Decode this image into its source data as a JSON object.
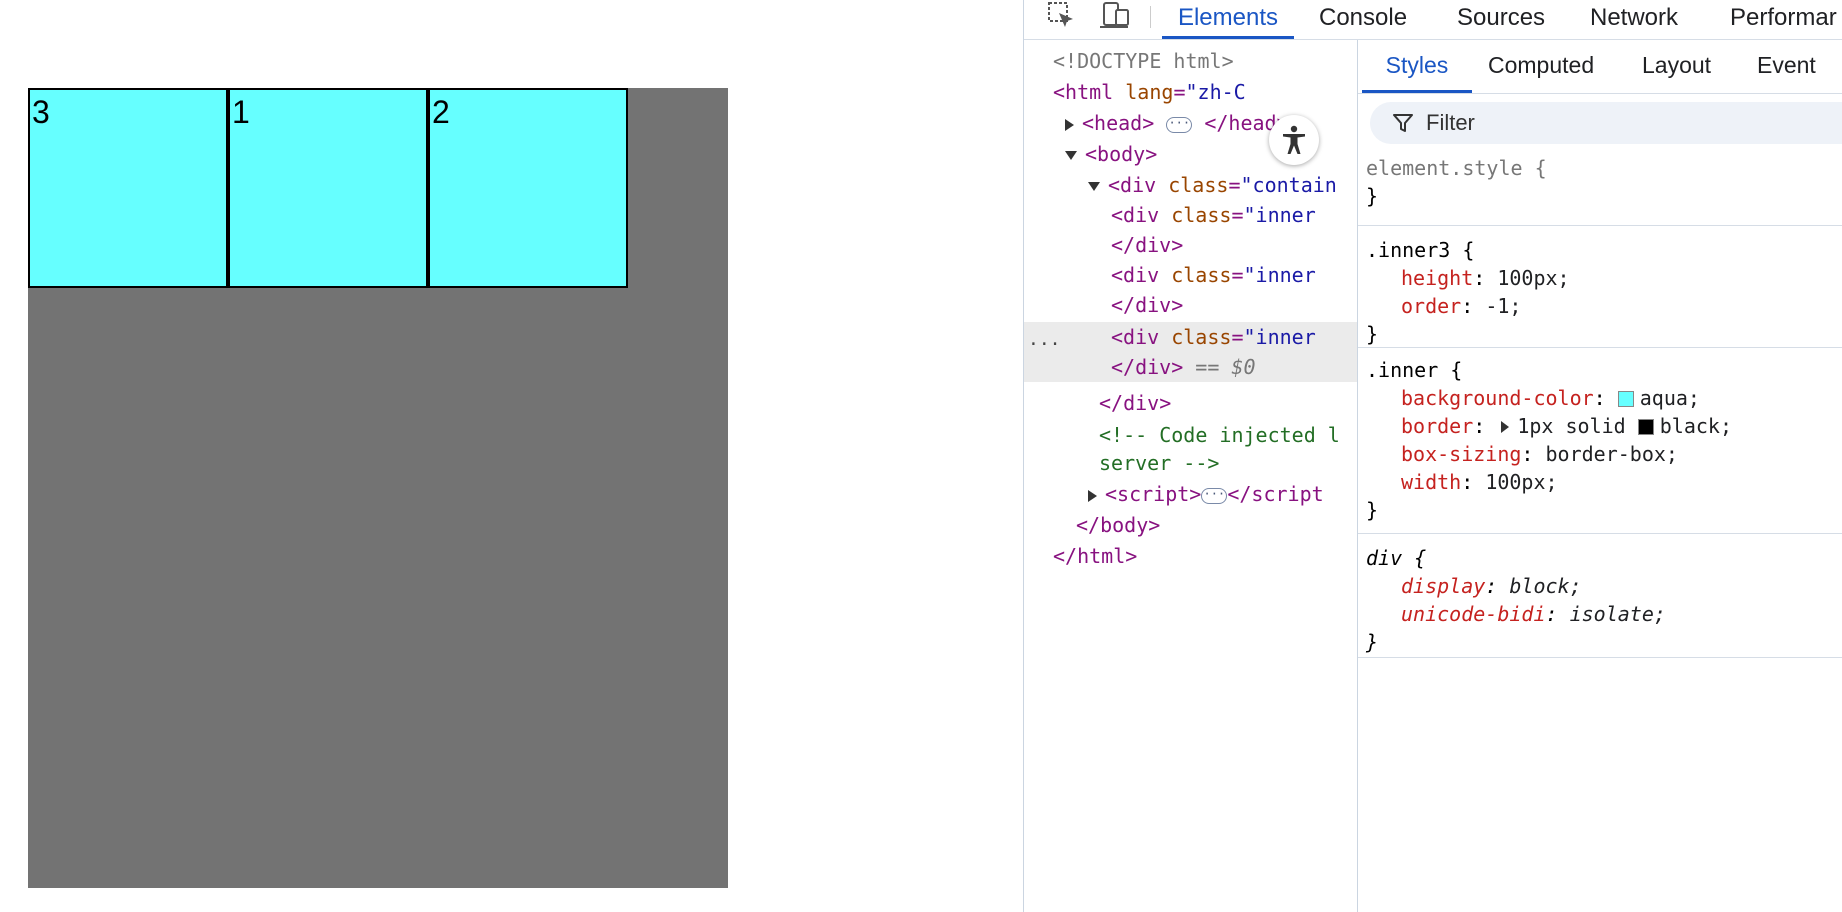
{
  "viewport": {
    "boxes": [
      {
        "label": "3"
      },
      {
        "label": "1"
      },
      {
        "label": "2"
      }
    ],
    "colors": {
      "container": "#737373",
      "inner": "#66ffff",
      "border": "#000000"
    }
  },
  "devtools": {
    "icons": [
      "inspect-element-icon",
      "device-toolbar-icon",
      "accessibility-icon",
      "filter-icon"
    ],
    "tabs": [
      "Elements",
      "Console",
      "Sources",
      "Network",
      "Performar"
    ],
    "active_tab": "Elements",
    "dom": {
      "doctype": "<!DOCTYPE html>",
      "html_open": "<html",
      "html_attr": "lang",
      "html_val": "\"zh-C",
      "head_open": "<head>",
      "head_close": "</head>",
      "ellipsis": "···",
      "body_open": "<body>",
      "div_open": "<div",
      "class_attr": "class",
      "container_val": "\"contain",
      "inner_val": "\"inner",
      "div_close": "</div>",
      "eq_ref": "== $0",
      "comment_1": "<!-- Code injected l",
      "comment_2": "server -->",
      "script_open": "<script>",
      "script_close": "</script",
      "body_close": "</body>",
      "html_close": "</html>",
      "row_menu": "···"
    },
    "style_tabs": [
      "Styles",
      "Computed",
      "Layout",
      "Event"
    ],
    "active_style_tab": "Styles",
    "filter_placeholder": "Filter",
    "rules": {
      "element_style": {
        "selector": "element.style {",
        "close": "}"
      },
      "inner3": {
        "selector": ".inner3 {",
        "height_prop": "height",
        "height_val": "100px;",
        "order_prop": "order",
        "order_val": "-1;",
        "close": "}"
      },
      "inner": {
        "selector": ".inner {",
        "bg_prop": "background-color",
        "bg_val": "aqua;",
        "bg_swatch": "#66ffff",
        "border_prop": "border",
        "border_val1": "1px solid",
        "border_val2": "black;",
        "border_swatch": "#000000",
        "boxsizing_prop": "box-sizing",
        "boxsizing_val": "border-box;",
        "width_prop": "width",
        "width_val": "100px;",
        "close": "}"
      },
      "div": {
        "selector": "div {",
        "display_prop": "display",
        "display_val": "block;",
        "bidi_prop": "unicode-bidi",
        "bidi_val": "isolate;",
        "close": "}"
      }
    }
  }
}
